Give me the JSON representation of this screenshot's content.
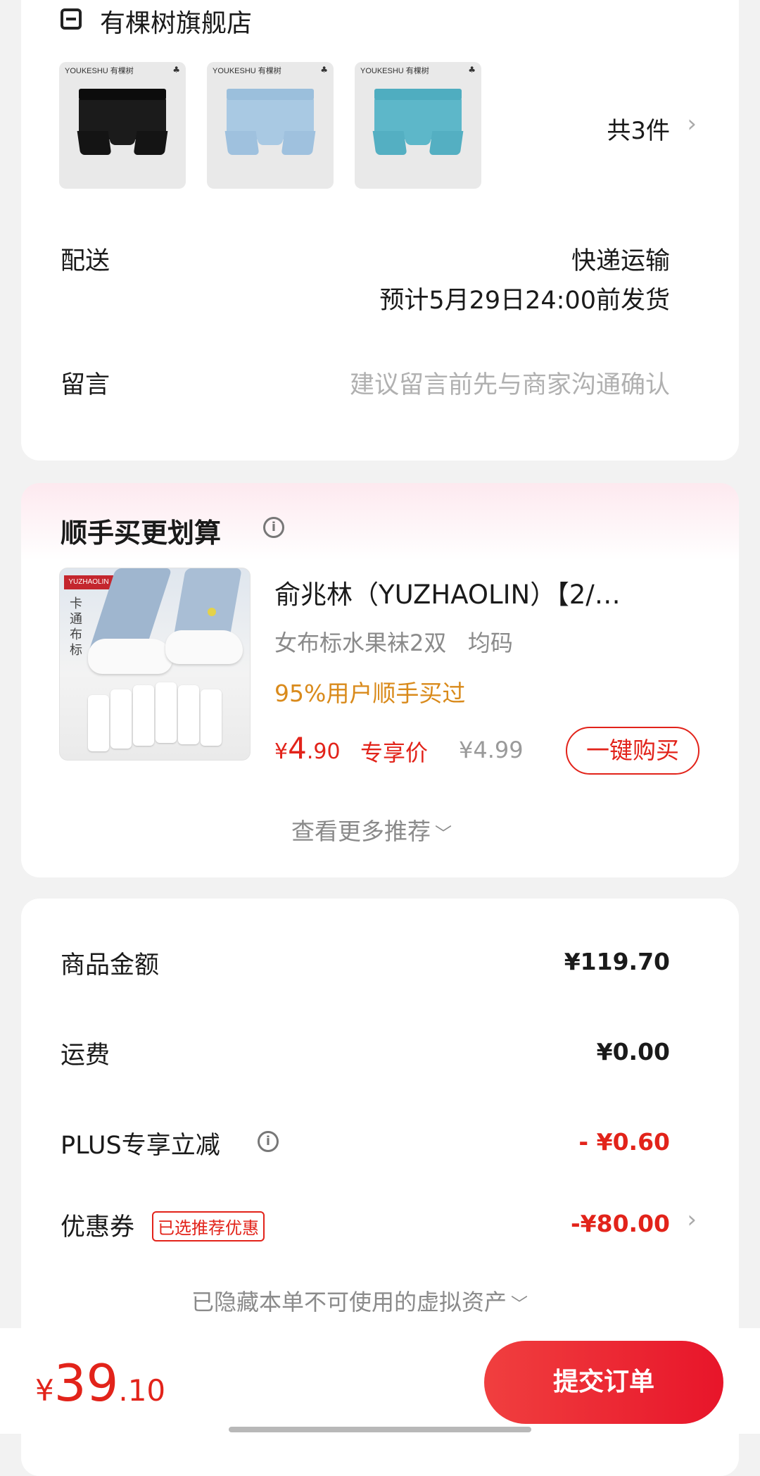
{
  "store": {
    "name": "有棵树旗舰店",
    "thumbnails": [
      {
        "brand": "YOUKESHU 有棵树",
        "color": "#1b1b1b",
        "band": "#0c0c0c"
      },
      {
        "brand": "YOUKESHU 有棵树",
        "color": "#a9c9e3",
        "band": "#9bbfdc"
      },
      {
        "brand": "YOUKESHU 有棵树",
        "color": "#5db7c9",
        "band": "#4fadc0"
      }
    ],
    "item_count": "共3件",
    "delivery_label": "配送",
    "delivery_method": "快递运输",
    "delivery_eta": "预计5月29日24:00前发货",
    "message_label": "留言",
    "message_placeholder": "建议留言前先与商家沟通确认"
  },
  "recommend": {
    "title": "顺手买更划算",
    "product_image_brand": "YUZHAOLIN",
    "product_image_text": "卡通布标",
    "product_title": "俞兆林（YUZHAOLIN）【2/…",
    "product_spec": "女布标水果袜2双   均码",
    "social_proof": "95%用户顺手买过",
    "price_symbol": "¥",
    "price_int": "4",
    "price_dec": ".90",
    "price_tag": "专享价",
    "original_price": "¥4.99",
    "buy_button": "一键购买",
    "more": "查看更多推荐"
  },
  "summary": {
    "goods_label": "商品金额",
    "goods_value": "¥119.70",
    "shipping_label": "运费",
    "shipping_value": "¥0.00",
    "plus_label": "PLUS专享立减",
    "plus_value": "- ¥0.60",
    "coupon_label": "优惠券",
    "coupon_badge": "已选推荐优惠",
    "coupon_value": "-¥80.00",
    "hidden_assets": "已隐藏本单不可使用的虚拟资产"
  },
  "bottom": {
    "total_symbol": "¥",
    "total_int": "39",
    "total_dec": ".10",
    "submit": "提交订单"
  },
  "colors": {
    "accent": "#e2231a",
    "social_proof": "#d98a1b"
  }
}
